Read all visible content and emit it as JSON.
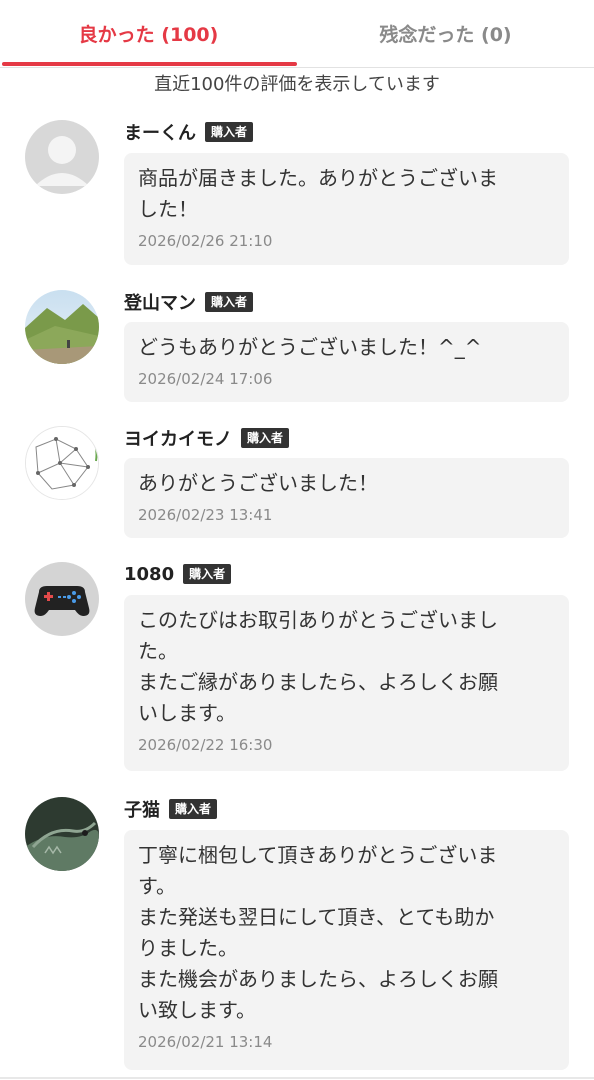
{
  "tabs": {
    "good_label": "良かった (100)",
    "bad_label": "残念だった (0)",
    "accent_color": "#e53945"
  },
  "notice": "直近100件の評価を表示しています",
  "reviews": [
    {
      "name": "まーくん",
      "badge": "購入者",
      "avatar": "default-user-icon",
      "message": "商品が届きました。ありがとうございま\nした！",
      "date": "2026/02/26 21:10"
    },
    {
      "name": "登山マン",
      "badge": "購入者",
      "avatar": "mountain-photo",
      "message": "どうもありがとうございました！^_^",
      "date": "2026/02/24 17:06"
    },
    {
      "name": "ヨイカイモノ",
      "badge": "購入者",
      "avatar": "network-sketch",
      "message": "ありがとうございました！",
      "date": "2026/02/23 13:41"
    },
    {
      "name": "1080",
      "badge": "購入者",
      "avatar": "gamepad-icon",
      "message": "このたびはお取引ありがとうございまし\nた。\nまたご縁がありましたら、よろしくお願\nいします。",
      "date": "2026/02/22 16:30"
    },
    {
      "name": "子猫",
      "badge": "購入者",
      "avatar": "iguana-photo",
      "message": "丁寧に梱包して頂きありがとうございま\nす。\nまた発送も翌日にして頂き、とても助か\nりました。\nまた機会がありましたら、よろしくお願\nい致します。",
      "date": "2026/02/21 13:14"
    }
  ]
}
